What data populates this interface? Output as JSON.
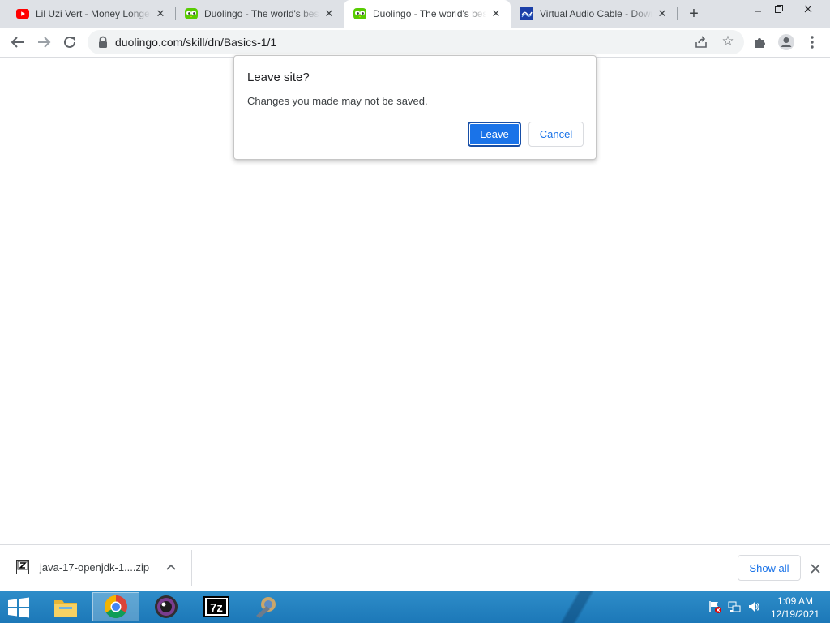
{
  "browser": {
    "tabs": [
      {
        "title": "Lil Uzi Vert - Money Longer",
        "icon": "youtube-icon"
      },
      {
        "title": "Duolingo - The world's best way to learn",
        "icon": "duolingo-icon"
      },
      {
        "title": "Duolingo - The world's best way to learn",
        "icon": "duolingo-icon",
        "active": true
      },
      {
        "title": "Virtual Audio Cable - Download",
        "icon": "vac-icon"
      }
    ],
    "new_tab": "+",
    "close_glyph": "✕",
    "url": "duolingo.com/skill/dn/Basics-1/1"
  },
  "dialog": {
    "title": "Leave site?",
    "message": "Changes you made may not be saved.",
    "leave_label": "Leave",
    "cancel_label": "Cancel"
  },
  "downloads": {
    "file_name": "java-17-openjdk-1....zip",
    "show_all_label": "Show all"
  },
  "taskbar": {
    "time": "1:09 AM",
    "date": "12/19/2021",
    "apps": [
      "file-explorer-icon",
      "chrome-icon",
      "obs-icon",
      "7zip-icon",
      "app-icon"
    ]
  },
  "colors": {
    "accent": "#1a73e8",
    "tabstrip": "#dee1e6",
    "taskbar": "#1c78b8"
  }
}
